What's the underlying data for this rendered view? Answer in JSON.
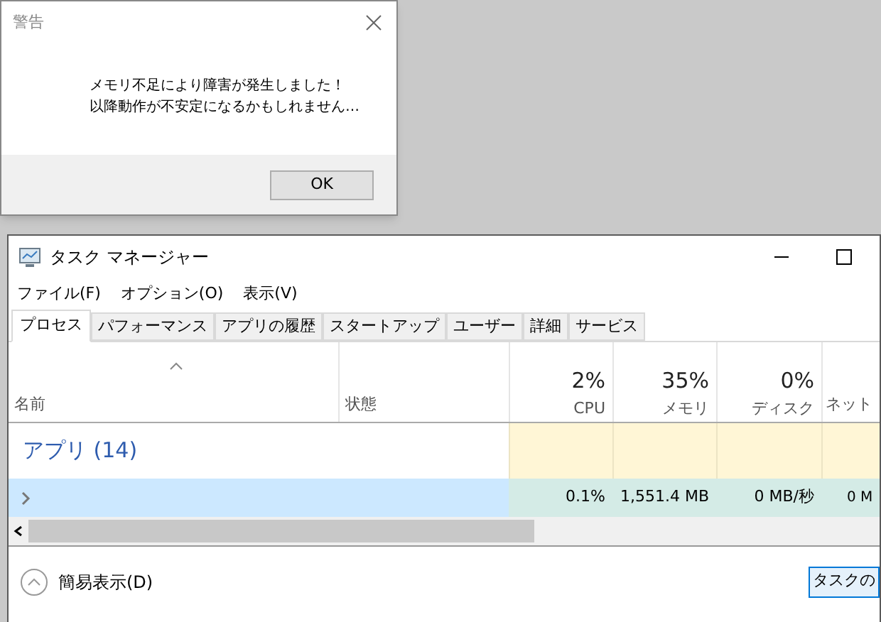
{
  "dialog": {
    "title": "警告",
    "message_lines": [
      "メモリ不足により障害が発生しました！",
      "以降動作が不安定になるかもしれません…"
    ],
    "ok_button": "OK"
  },
  "window": {
    "title": "タスク マネージャー"
  },
  "menu": [
    "ファイル(F)",
    "オプション(O)",
    "表示(V)"
  ],
  "tabs": [
    {
      "label": "プロセス",
      "selected": true
    },
    {
      "label": "パフォーマンス",
      "selected": false
    },
    {
      "label": "アプリの履歴",
      "selected": false
    },
    {
      "label": "スタートアップ",
      "selected": false
    },
    {
      "label": "ユーザー",
      "selected": false
    },
    {
      "label": "詳細",
      "selected": false
    },
    {
      "label": "サービス",
      "selected": false
    }
  ],
  "columns": [
    {
      "label": "名前"
    },
    {
      "label": "状態"
    },
    {
      "label": "CPU",
      "percent": "2%"
    },
    {
      "label": "メモリ",
      "percent": "35%"
    },
    {
      "label": "ディスク",
      "percent": "0%"
    },
    {
      "label": "ネット"
    }
  ],
  "group": {
    "label": "アプリ (14)"
  },
  "rows": [
    {
      "selected": true,
      "cells": [
        "0.1%",
        "1,551.4 MB",
        "0 MB/秒",
        "0 M"
      ]
    }
  ],
  "footer": {
    "fewer_details": "簡易表示(D)",
    "end_task_button": "タスクの"
  }
}
